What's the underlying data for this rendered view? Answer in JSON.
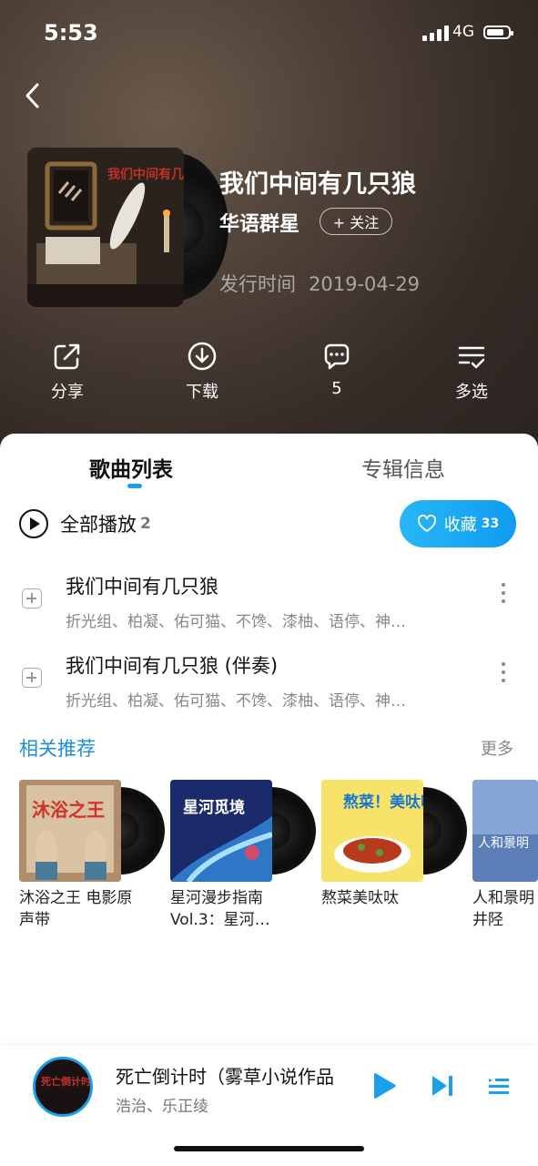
{
  "status_bar": {
    "time": "5:53",
    "network": "4G"
  },
  "album": {
    "title": "我们中间有几只狼",
    "artist": "华语群星",
    "follow_label": "+ 关注",
    "release_label": "发行时间",
    "release_date": "2019-04-29",
    "cover_text": "我们中间有几只狼"
  },
  "actions": [
    {
      "label": "分享",
      "icon": "share-icon"
    },
    {
      "label": "下载",
      "icon": "download-icon"
    },
    {
      "label": "5",
      "icon": "comment-icon"
    },
    {
      "label": "多选",
      "icon": "multiselect-icon"
    }
  ],
  "tabs": {
    "songs": "歌曲列表",
    "info": "专辑信息"
  },
  "play_all": {
    "label": "全部播放",
    "count": "2"
  },
  "collect": {
    "label": "收藏",
    "count": "33"
  },
  "songs": [
    {
      "title": "我们中间有几只狼",
      "artists": "折光组、柏凝、佑可猫、不馋、漆柚、语停、神…"
    },
    {
      "title": "我们中间有几只狼 (伴奏)",
      "artists": "折光组、柏凝、佑可猫、不馋、漆柚、语停、神…"
    }
  ],
  "recommend": {
    "heading": "相关推荐",
    "more": "更多",
    "items": [
      {
        "name": "沐浴之王 电影原声带",
        "cover_text": "沐浴之王"
      },
      {
        "name": "星河漫步指南Vol.3：星河…",
        "cover_text": "星河觅境"
      },
      {
        "name": "熬菜美呔呔",
        "cover_text": "熬菜！美呔呔"
      },
      {
        "name": "人和景明井陉",
        "cover_text": "人和景明"
      }
    ]
  },
  "player": {
    "title": "死亡倒计时（雾草小说作品",
    "artist": "浩治、乐正绫",
    "disc_text": "死亡倒计时"
  },
  "colors": {
    "accent": "#1aa0ea"
  }
}
